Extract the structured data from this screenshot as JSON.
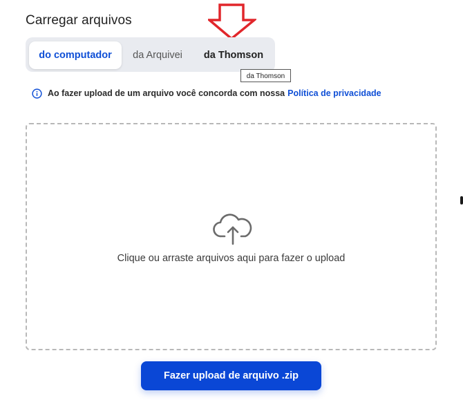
{
  "header": {
    "title": "Carregar arquivos"
  },
  "tabs": [
    {
      "label": "do computador",
      "active": true
    },
    {
      "label": "da Arquivei",
      "active": false
    },
    {
      "label": "da Thomson",
      "active": false
    }
  ],
  "tooltip": {
    "text": "da Thomson"
  },
  "notice": {
    "icon": "info-icon",
    "text": "Ao fazer upload de um arquivo você concorda com nossa",
    "link_label": "Política de privacidade"
  },
  "dropzone": {
    "icon": "cloud-upload-icon",
    "text": "Clique ou arraste arquivos aqui para fazer o upload"
  },
  "actions": {
    "upload_label": "Fazer upload de arquivo .zip"
  },
  "colors": {
    "accent": "#0f4fd6",
    "button": "#0a47d6",
    "arrow": "#e1262b",
    "tab_bg": "#e9ebf0"
  }
}
